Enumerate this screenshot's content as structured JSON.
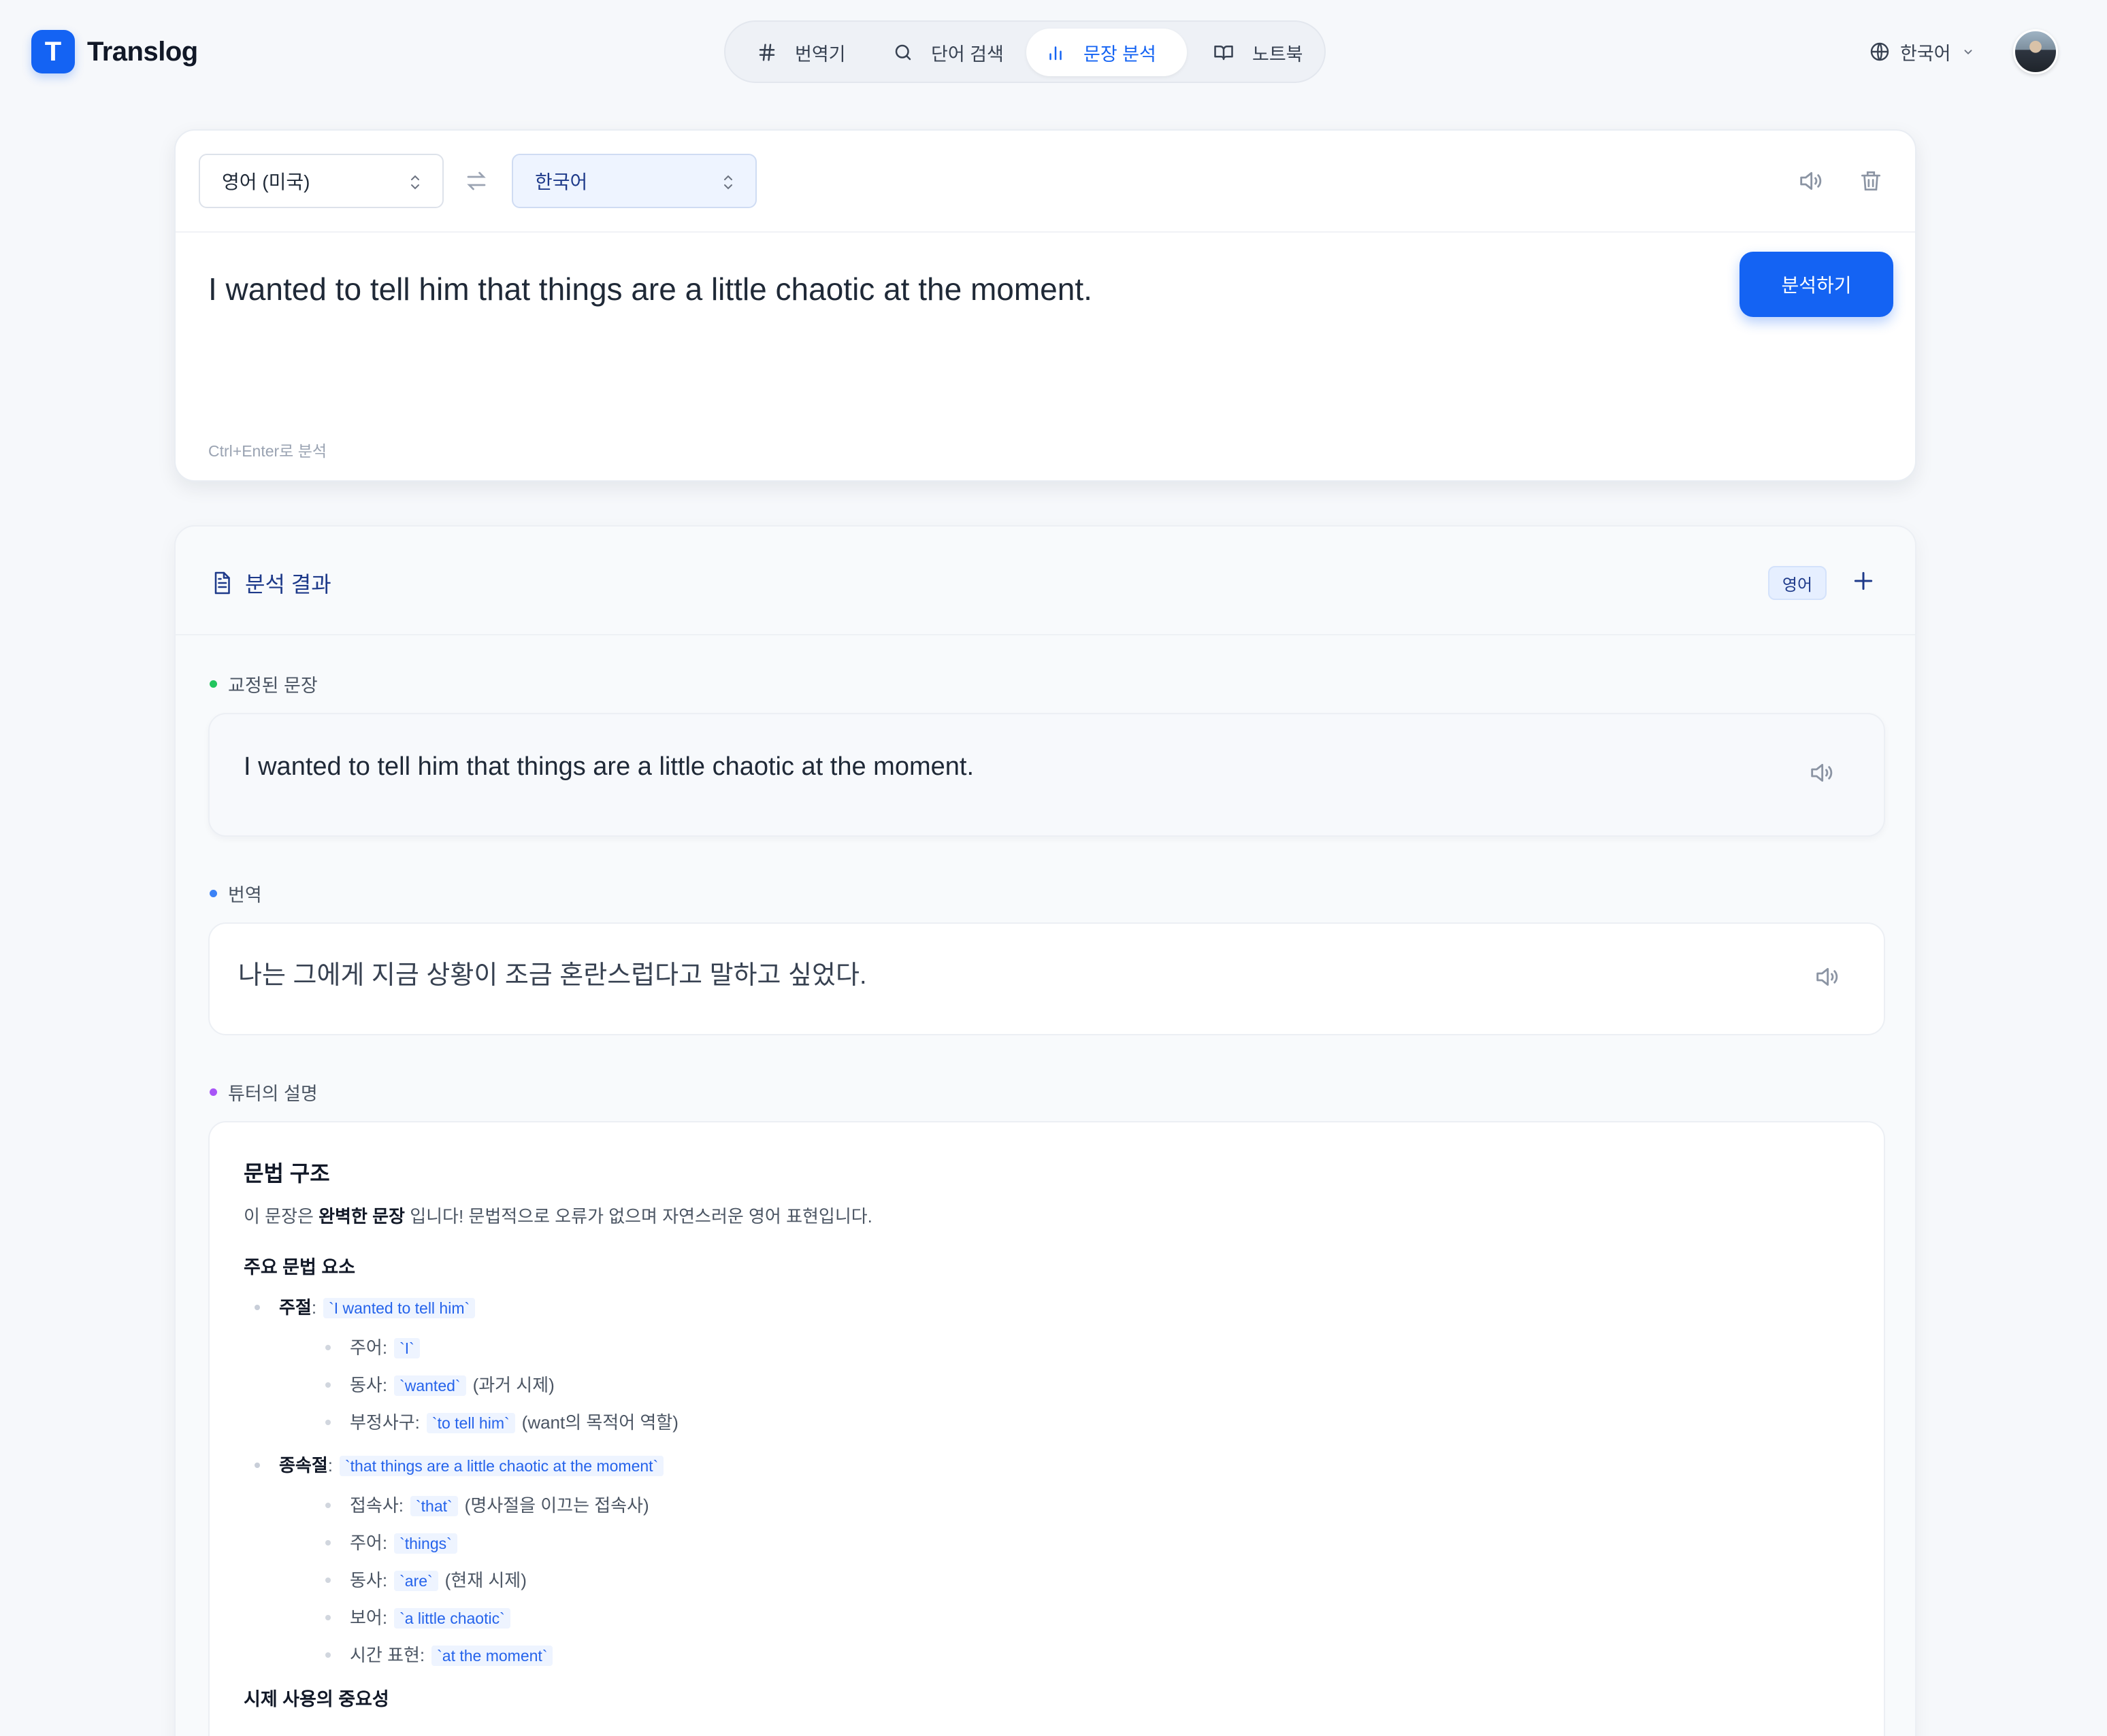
{
  "app": {
    "logo_letter": "T",
    "name": "Translog"
  },
  "nav": {
    "items": [
      {
        "label": "번역기",
        "icon": "hash-icon"
      },
      {
        "label": "단어 검색",
        "icon": "search-icon"
      },
      {
        "label": "문장 분석",
        "icon": "bar-chart-icon",
        "active": true
      },
      {
        "label": "노트북",
        "icon": "book-icon"
      }
    ]
  },
  "header": {
    "ui_language": "한국어"
  },
  "input": {
    "source_language": "영어 (미국)",
    "target_language": "한국어",
    "text": "I wanted to tell him that things are a little chaotic at the moment.",
    "analyze_label": "분석하기",
    "hint": "Ctrl+Enter로 분석"
  },
  "result": {
    "title": "분석 결과",
    "language_badge": "영어",
    "corrected_label": "교정된 문장",
    "corrected_text": "I wanted to tell him that things are a little chaotic at the moment.",
    "translation_label": "번역",
    "translation_text": "나는 그에게 지금 상황이 조금 혼란스럽다고 말하고 싶었다.",
    "tutor_label": "튜터의 설명",
    "tutor": {
      "heading": "문법 구조",
      "intro_prefix": "이 문장은 ",
      "intro_bold": "완벽한 문장",
      "intro_suffix": " 입니다! 문법적으로 오류가 없으며 자연스러운 영어 표현입니다.",
      "elements_heading": "주요 문법 요소",
      "main_clause": {
        "label": "주절",
        "code": "`I wanted to tell him`",
        "items": [
          {
            "label": "주어:",
            "code": "`I`",
            "note": ""
          },
          {
            "label": "동사:",
            "code": "`wanted`",
            "note": "(과거 시제)"
          },
          {
            "label": "부정사구:",
            "code": "`to tell him`",
            "note": "(want의 목적어 역할)"
          }
        ]
      },
      "sub_clause": {
        "label": "종속절",
        "code": "`that things are a little chaotic at the moment`",
        "items": [
          {
            "label": "접속사:",
            "code": "`that`",
            "note": "(명사절을 이끄는 접속사)"
          },
          {
            "label": "주어:",
            "code": "`things`",
            "note": ""
          },
          {
            "label": "동사:",
            "code": "`are`",
            "note": "(현재 시제)"
          },
          {
            "label": "보어:",
            "code": "`a little chaotic`",
            "note": ""
          },
          {
            "label": "시간 표현:",
            "code": "`at the moment`",
            "note": ""
          }
        ]
      },
      "tense_heading": "시제 사용의 중요성"
    }
  },
  "colors": {
    "accent": "#1463f3",
    "corrected_dot": "#22c55e",
    "translation_dot": "#3b82f6",
    "tutor_dot": "#a855f7"
  }
}
